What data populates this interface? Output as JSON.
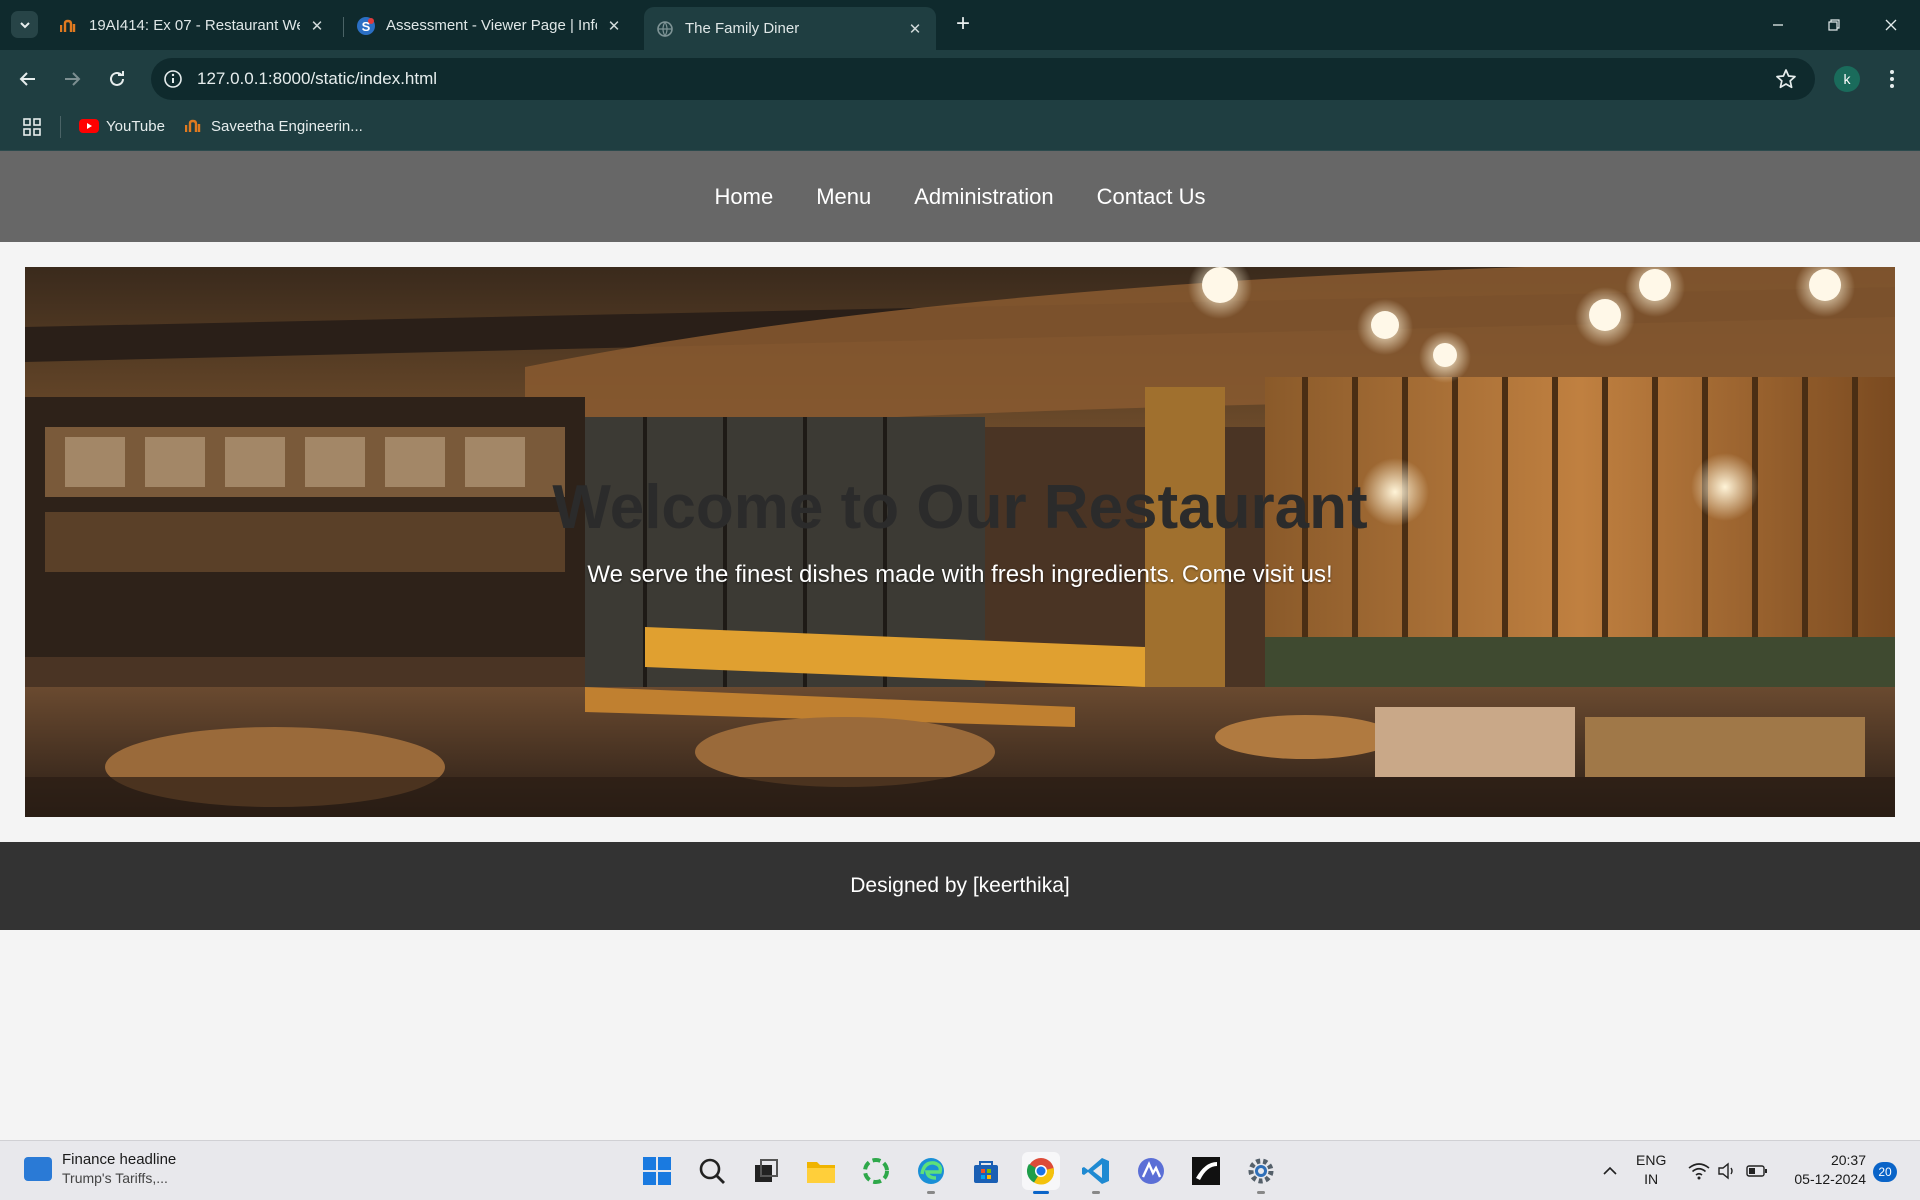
{
  "browser": {
    "tabs": [
      {
        "title": "19AI414: Ex 07 - Restaurant We",
        "favicon": "saveetha-logo-icon"
      },
      {
        "title": "Assessment - Viewer Page | Info",
        "favicon": "s-logo-icon"
      },
      {
        "title": "The Family Diner",
        "favicon": "globe-icon",
        "active": true
      }
    ],
    "url": "127.0.0.1:8000/static/index.html",
    "profile_initial": "k",
    "bookmarks": [
      {
        "label": "YouTube",
        "favicon": "youtube-icon"
      },
      {
        "label": "Saveetha Engineerin...",
        "favicon": "saveetha-logo-icon"
      }
    ]
  },
  "site": {
    "nav": [
      "Home",
      "Menu",
      "Administration",
      "Contact Us"
    ],
    "hero_title": "Welcome to Our Restaurant",
    "hero_subtitle": "We serve the finest dishes made with fresh ingredients. Come visit us!",
    "footer": "Designed by [keerthika]"
  },
  "taskbar": {
    "widget_title": "Finance headline",
    "widget_subtitle": "Trump's Tariffs,...",
    "apps": [
      "start-icon",
      "search-icon",
      "task-view-icon",
      "file-explorer-icon",
      "copilot-icon",
      "edge-icon",
      "store-icon",
      "chrome-icon",
      "vscode-icon",
      "arc-icon",
      "app-icon",
      "settings-icon"
    ],
    "lang_line1": "ENG",
    "lang_line2": "IN",
    "time": "20:37",
    "date": "05-12-2024",
    "notifications": "20"
  }
}
